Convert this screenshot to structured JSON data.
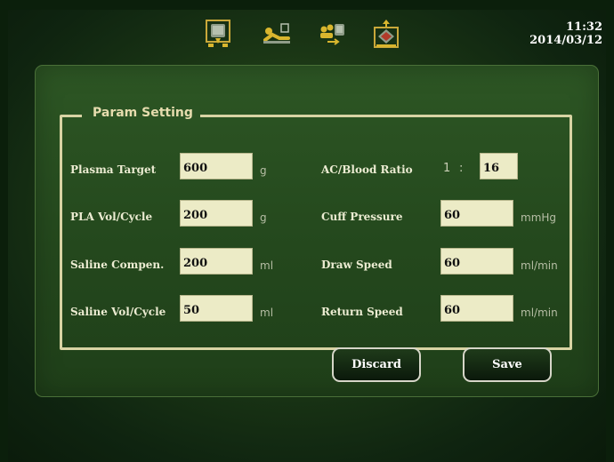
{
  "header": {
    "mode_icons": [
      {
        "name": "collection-bag-icon",
        "active": true
      },
      {
        "name": "donor-recline-icon",
        "active": false
      },
      {
        "name": "transfer-people-icon",
        "active": false
      },
      {
        "name": "return-bag-icon",
        "active": false
      }
    ],
    "time": "11:32",
    "date": "2014/03/12"
  },
  "panel": {
    "title": "Param Setting",
    "left_params": [
      {
        "label": "Plasma Target",
        "value": "600",
        "unit": "g"
      },
      {
        "label": "PLA Vol/Cycle",
        "value": "200",
        "unit": "g"
      },
      {
        "label": "Saline Compen.",
        "value": "200",
        "unit": "ml"
      },
      {
        "label": "Saline Vol/Cycle",
        "value": "50",
        "unit": "ml"
      }
    ],
    "ac_ratio": {
      "label": "AC/Blood Ratio",
      "prefix": "1",
      "separator": ":",
      "value": "16"
    },
    "right_params": [
      {
        "label": "Cuff Pressure",
        "value": "60",
        "unit": "mmHg"
      },
      {
        "label": "Draw Speed",
        "value": "60",
        "unit": "ml/min"
      },
      {
        "label": "Return Speed",
        "value": "60",
        "unit": "ml/min"
      }
    ]
  },
  "buttons": {
    "discard": "Discard",
    "save": "Save"
  },
  "colors": {
    "field_bg": "#ecebc6",
    "legend_text": "#e6dcae",
    "frame": "#d8d3a3",
    "accent_gold": "#d9b62e"
  }
}
